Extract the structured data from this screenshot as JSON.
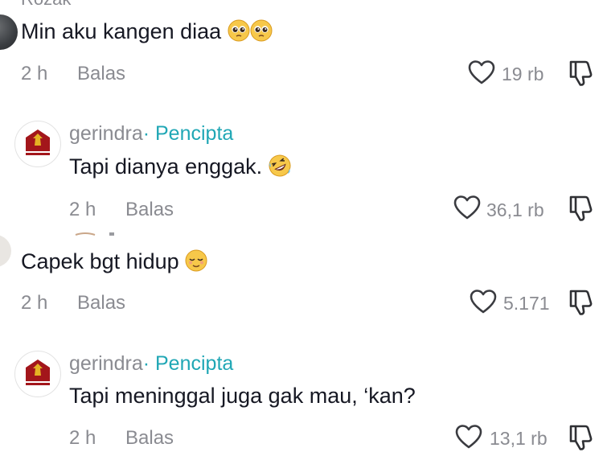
{
  "comments": [
    {
      "username": "Rozak",
      "text": "Min aku kangen diaa",
      "emojis": [
        "pleading-face-emoji",
        "pleading-face-emoji"
      ],
      "time": "2 h",
      "reply_label": "Balas",
      "likes": "19 rb"
    },
    {
      "username": "gerindra",
      "creator_label": "· Pencipta",
      "text": "Tapi dianya enggak.",
      "emojis": [
        "rolling-on-floor-laughing-emoji"
      ],
      "time": "2 h",
      "reply_label": "Balas",
      "likes": "36,1 rb"
    },
    {
      "username": "",
      "text": "Capek bgt hidup",
      "emojis": [
        "relieved-face-emoji"
      ],
      "time": "2 h",
      "reply_label": "Balas",
      "likes": "5.171"
    },
    {
      "username": "gerindra",
      "creator_label": "· Pencipta",
      "text": "Tapi meninggal juga gak mau, ‘kan?",
      "emojis": [],
      "time": "2 h",
      "reply_label": "Balas",
      "likes": "13,1 rb"
    }
  ],
  "colors": {
    "text": "#161823",
    "secondary": "#8a8b91",
    "creator_accent": "#20a7b5",
    "gerindra_red": "#a3161b",
    "gerindra_gold": "#e5b224"
  }
}
